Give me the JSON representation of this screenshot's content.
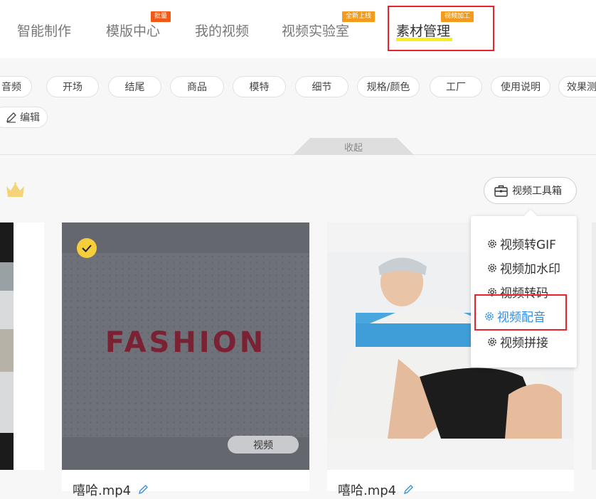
{
  "topnav": {
    "items": [
      {
        "label": "智能制作"
      },
      {
        "label": "模版中心",
        "badge": "批量"
      },
      {
        "label": "我的视频"
      },
      {
        "label": "视频实验室",
        "badge": "全新上线"
      },
      {
        "label": "素材管理",
        "badge": "视频加工",
        "active": true
      }
    ]
  },
  "filters": {
    "chips": [
      "音频",
      "开场",
      "结尾",
      "商品",
      "模特",
      "细节",
      "规格/颜色",
      "工厂",
      "使用说明",
      "效果测"
    ],
    "edit_label": "编辑",
    "collapse_label": "收起"
  },
  "toolbar": {
    "toolbox_label": "视频工具箱"
  },
  "toolbox_menu": {
    "items": [
      {
        "label": "视频转GIF"
      },
      {
        "label": "视频加水印"
      },
      {
        "label": "视频转码"
      },
      {
        "label": "视频配音",
        "active": true
      },
      {
        "label": "视频拼接"
      }
    ]
  },
  "cards": [
    {
      "overlay_text": "FASHION",
      "type_pill": "视频",
      "filename": "嘻哈.mp4",
      "selected": true
    },
    {
      "filename": "嘻哈.mp4"
    }
  ],
  "colors": {
    "accent_blue": "#2b8fe6",
    "badge_red": "#f05a16",
    "badge_orange": "#f39b1c",
    "highlight_red": "#e8232a",
    "underline_yellow": "#f7ee1f",
    "check_yellow": "#f6cd3a"
  }
}
